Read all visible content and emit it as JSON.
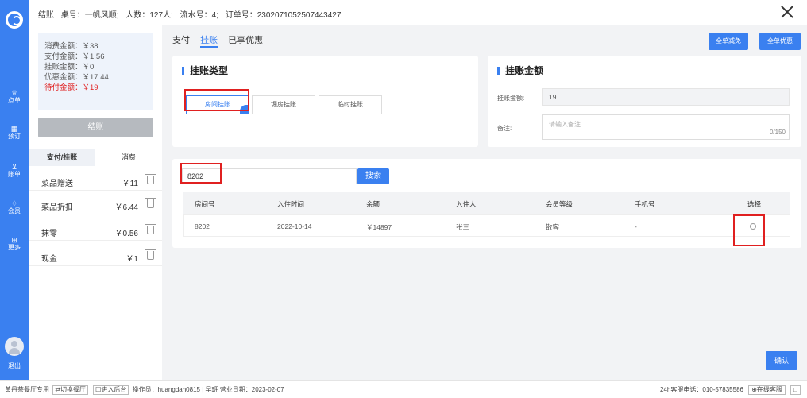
{
  "nav": {
    "items": [
      {
        "icon": "bell-icon",
        "glyph": "♕",
        "label": "点单"
      },
      {
        "icon": "calendar-icon",
        "glyph": "▦",
        "label": "预订"
      },
      {
        "icon": "chart-icon",
        "glyph": "⊻",
        "label": "账单"
      },
      {
        "icon": "diamond-icon",
        "glyph": "♢",
        "label": "会员"
      },
      {
        "icon": "grid-icon",
        "glyph": "⊞",
        "label": "更多"
      }
    ],
    "logout": "退出"
  },
  "header": {
    "title": "结账",
    "table": "桌号：一帆风顺;",
    "people": "人数：127人;",
    "serial": "流水号：4;",
    "order": "订单号：2302071052507443427"
  },
  "summary": {
    "consume": "消费金额：￥38",
    "paid": "支付金额：￥1.56",
    "credit": "挂账金额：￥0",
    "discount": "优惠金额：￥17.44",
    "pending": "待付金额：￥19"
  },
  "checkout_label": "结账",
  "left_tabs": [
    "支付/挂账",
    "消费"
  ],
  "payments": [
    {
      "name": "菜品赠送",
      "amount": "￥11"
    },
    {
      "name": "菜品折扣",
      "amount": "￥6.44"
    },
    {
      "name": "抹零",
      "amount": "￥0.56"
    },
    {
      "name": "现金",
      "amount": "￥1"
    }
  ],
  "tabs": [
    "支付",
    "挂账",
    "已享优惠"
  ],
  "top_buttons": [
    "全单减免",
    "全单优惠"
  ],
  "credit_type": {
    "title": "挂账类型",
    "options": [
      "房间挂账",
      "堀房挂账",
      "临时挂账"
    ]
  },
  "credit_amount": {
    "title": "挂账金额",
    "amount_label": "挂账金额:",
    "amount_value": "19",
    "remark_label": "备注:",
    "remark_placeholder": "请输入备注",
    "remark_count": "0/150"
  },
  "search": {
    "value": "8202",
    "button": "搜索"
  },
  "table": {
    "headers": [
      "房间号",
      "入住时间",
      "余额",
      "入住人",
      "会员等级",
      "手机号",
      "选择"
    ],
    "rows": [
      [
        "8202",
        "2022-10-14",
        "￥14897",
        "张三",
        "散客",
        "-"
      ]
    ]
  },
  "confirm_label": "确认",
  "status": {
    "store": "黄丹茶餐厅专用",
    "switch": "⇄切换餐厅",
    "backend": "☐进入后台",
    "operator": "操作员：huangdan0815",
    "shift": "早班",
    "business_date": "营业日期：2023-02-07",
    "hotline": "24h客服电话：010-57835586",
    "online": "⊕在线客服",
    "square": "□"
  },
  "colors": {
    "primary": "#3a80f0",
    "warn": "#e02020"
  }
}
